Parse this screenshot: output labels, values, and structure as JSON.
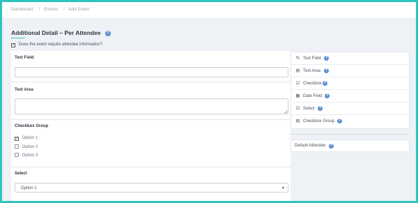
{
  "breadcrumb": [
    "Dashboard",
    "Events",
    "Add Event"
  ],
  "page": {
    "title": "Additional Detail – Per Attendee",
    "require_label": "Does the event require attendee information?",
    "require_checked": true
  },
  "form": {
    "text_field": {
      "label": "Text Field",
      "value": ""
    },
    "text_area": {
      "label": "Text Area",
      "value": ""
    },
    "checkbox_group": {
      "label": "Checkbox Group",
      "options": [
        {
          "label": "Option 1",
          "checked": true
        },
        {
          "label": "Option 2",
          "checked": false
        },
        {
          "label": "Option 3",
          "checked": false
        }
      ]
    },
    "select": {
      "label": "Select",
      "value": "Option 1"
    }
  },
  "palette": {
    "items": [
      {
        "label": "Text Field",
        "icon": "text-field-icon",
        "glyph": "⇆"
      },
      {
        "label": "Text Area",
        "icon": "text-area-icon",
        "glyph": "▤"
      },
      {
        "label": "Checkbox",
        "icon": "checkbox-icon",
        "glyph": "☑"
      },
      {
        "label": "Date Field",
        "icon": "calendar-icon",
        "glyph": "▦"
      },
      {
        "label": "Select",
        "icon": "select-icon",
        "glyph": "☑"
      },
      {
        "label": "Checkbox Group",
        "icon": "checkbox-group-icon",
        "glyph": "▤"
      }
    ]
  },
  "default_attendee": {
    "label": "Default Attendee"
  },
  "colors": {
    "accent": "#2fc3bd",
    "help": "#5b8fd0",
    "background": "#eef1f5"
  }
}
